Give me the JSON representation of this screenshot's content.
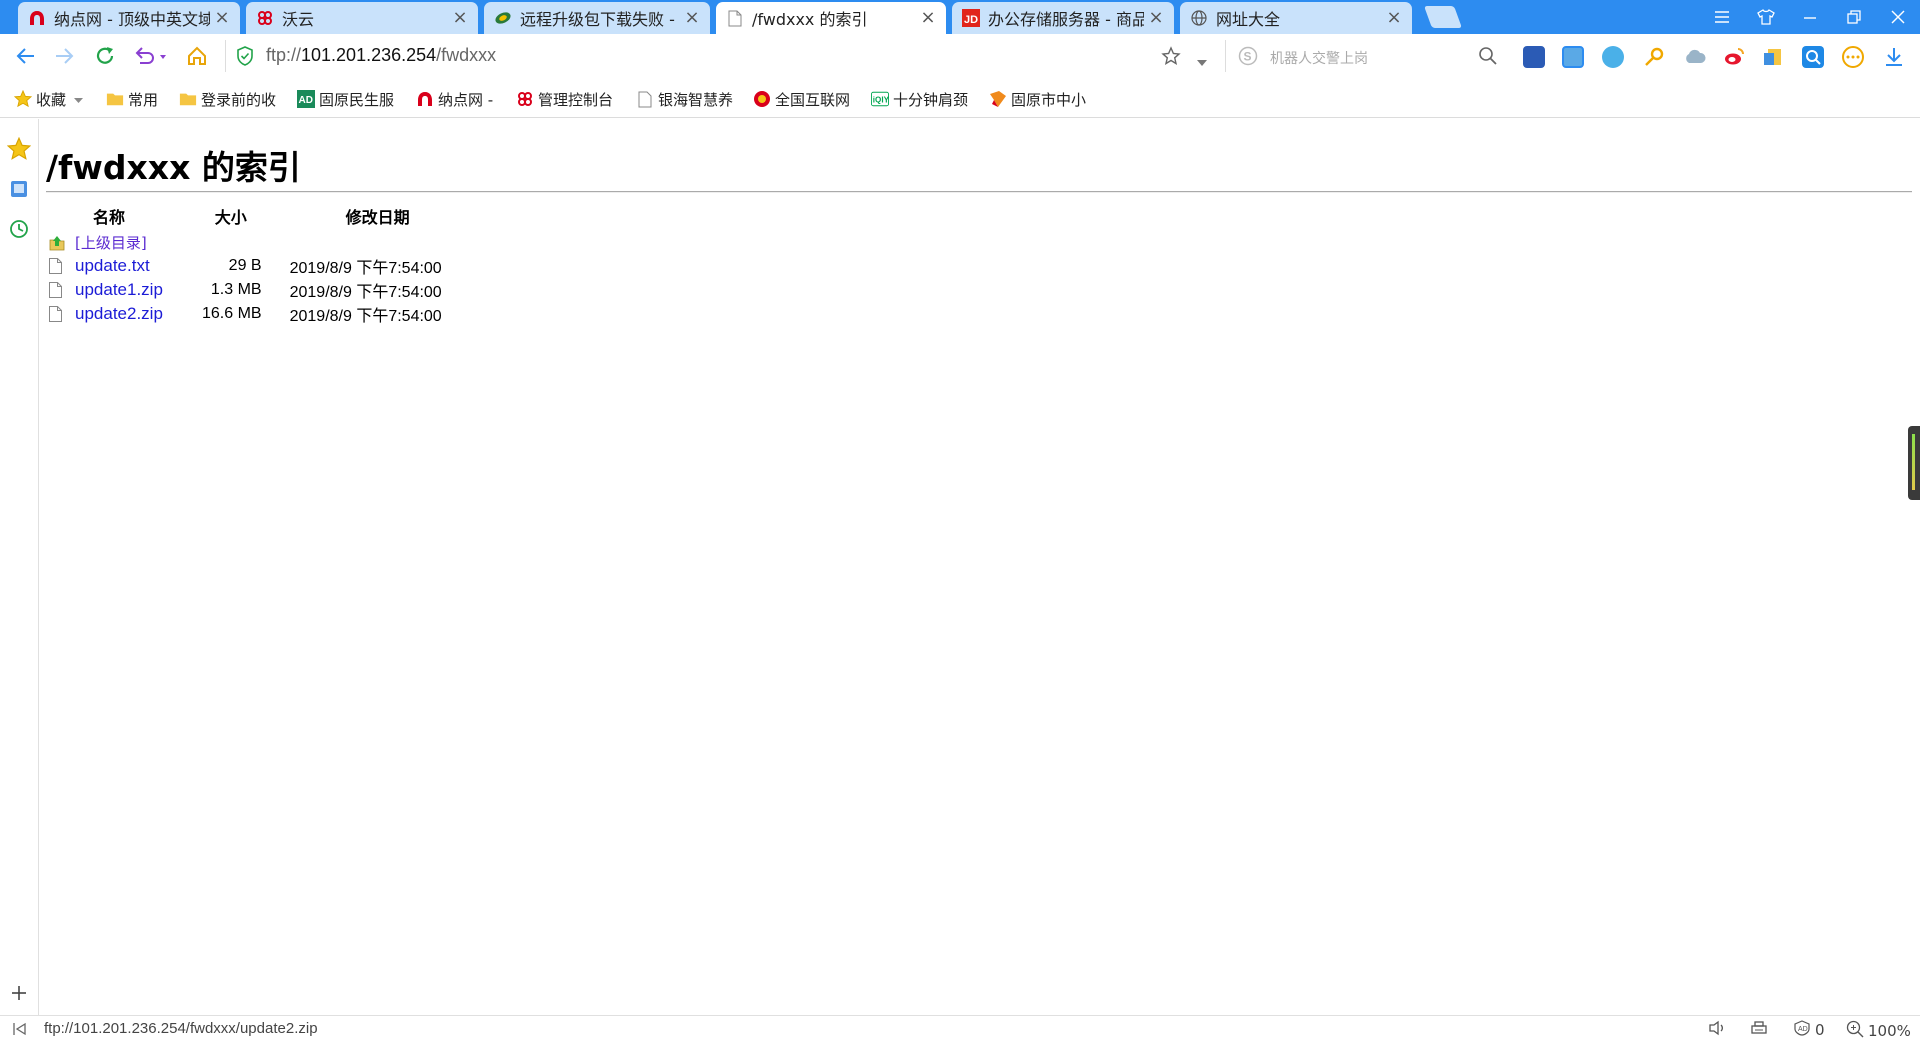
{
  "tabs": [
    {
      "label": "纳点网 - 顶级中英文域名",
      "icon": "nadian-icon",
      "active": false
    },
    {
      "label": "沃云",
      "icon": "unicom-icon",
      "active": false
    },
    {
      "label": "远程升级包下载失败 - 专",
      "icon": "community-icon",
      "active": false
    },
    {
      "label": "/fwdxxx 的索引",
      "icon": "page-icon",
      "active": true
    },
    {
      "label": "办公存储服务器 - 商品搜",
      "icon": "jd-icon",
      "active": false
    },
    {
      "label": "网址大全",
      "icon": "globe-icon",
      "active": false
    }
  ],
  "address": {
    "scheme": "ftp://",
    "host": "101.201.236.254",
    "path": "/fwdxxx"
  },
  "search": {
    "placeholder": "机器人交警上岗"
  },
  "bookmarks": [
    {
      "label": "收藏",
      "icon": "star-icon"
    },
    {
      "label": "常用",
      "icon": "folder-icon"
    },
    {
      "label": "登录前的收",
      "icon": "folder-icon"
    },
    {
      "label": "固原民生服",
      "icon": "ad-icon"
    },
    {
      "label": "纳点网 -",
      "icon": "nadian-icon"
    },
    {
      "label": "管理控制台",
      "icon": "unicom-icon"
    },
    {
      "label": "银海智慧养",
      "icon": "page-icon"
    },
    {
      "label": "全国互联网",
      "icon": "emblem-icon"
    },
    {
      "label": "十分钟肩颈",
      "icon": "iqiyi-icon"
    },
    {
      "label": "固原市中小",
      "icon": "school-icon"
    }
  ],
  "page": {
    "title": "/fwdxxx 的索引",
    "columns": {
      "name": "名称",
      "size": "大小",
      "date": "修改日期"
    },
    "parent_link": "[上级目录]",
    "files": [
      {
        "name": "update.txt",
        "size": "29 B",
        "date": "2019/8/9 下午7:54:00"
      },
      {
        "name": "update1.zip",
        "size": "1.3 MB",
        "date": "2019/8/9 下午7:54:00"
      },
      {
        "name": "update2.zip",
        "size": "16.6 MB",
        "date": "2019/8/9 下午7:54:00"
      }
    ]
  },
  "status": {
    "hover_url": "ftp://101.201.236.254/fwdxxx/update2.zip",
    "adblock_count": "0",
    "zoom": "100%"
  },
  "colors": {
    "accent": "#2d8cf0",
    "tab_inactive": "#c9e2fb",
    "link": "#1b1bd6",
    "visited": "#5b2bd1"
  }
}
